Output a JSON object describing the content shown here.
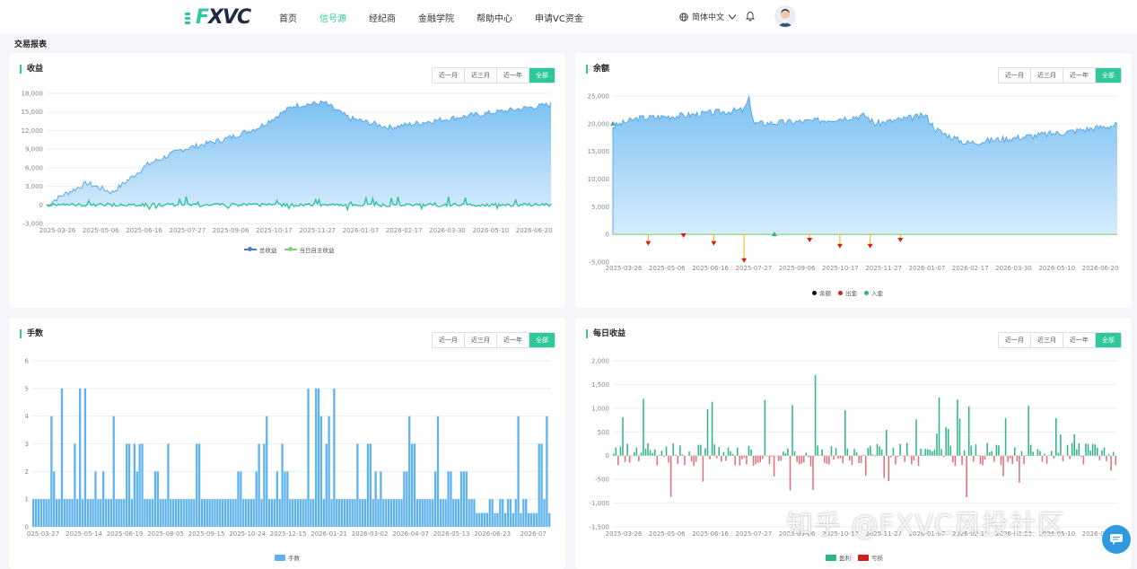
{
  "header": {
    "logo_text": "FXVC",
    "nav": [
      {
        "label": "首页",
        "active": false
      },
      {
        "label": "信号源",
        "active": true
      },
      {
        "label": "经纪商",
        "active": false
      },
      {
        "label": "金融学院",
        "active": false
      },
      {
        "label": "帮助中心",
        "active": false
      },
      {
        "label": "申请VC资金",
        "active": false
      }
    ],
    "language": "简体中文",
    "icons": [
      "globe-icon",
      "chevron-down-icon",
      "bell-icon",
      "avatar"
    ]
  },
  "page_title": "交易报表",
  "range_options": [
    "近一月",
    "近三月",
    "近一年",
    "全部"
  ],
  "range_selected": "全部",
  "watermark": "知乎 @FXVC风投社区",
  "colors": {
    "accent": "#2fc79c",
    "blue": "#5eb3ee",
    "profit": "#2fb38a",
    "loss": "#e0707a",
    "red": "#d0201a",
    "yellow": "#f5c11b"
  },
  "panels": {
    "profit": {
      "title": "收益",
      "legend": [
        "总收益",
        "当日自主收益"
      ]
    },
    "balance": {
      "title": "余额",
      "legend": [
        "余额",
        "出金",
        "入金"
      ]
    },
    "lots": {
      "title": "手数",
      "legend": [
        "手数"
      ]
    },
    "daily": {
      "title": "每日收益",
      "legend": [
        "盈利",
        "亏损"
      ]
    }
  },
  "chart_data": [
    {
      "type": "area",
      "id": "profit",
      "title": "收益",
      "x_ticks": [
        "2025-03-26",
        "2025-05-06",
        "2025-06-16",
        "2025-07-27",
        "2025-09-06",
        "2025-10-17",
        "2025-11-27",
        "2026-01-07",
        "2026-02-17",
        "2026-03-30",
        "2026-05-10",
        "2026-06-20"
      ],
      "y_ticks": [
        "18,000",
        "15,000",
        "12,000",
        "9,000",
        "6,000",
        "3,000",
        "0",
        "-3,000"
      ],
      "ylim": [
        -3000,
        18000
      ],
      "series": [
        {
          "name": "总收益",
          "key_points": [
            [
              0,
              0
            ],
            [
              0.03,
              1500
            ],
            [
              0.08,
              3500
            ],
            [
              0.13,
              2000
            ],
            [
              0.2,
              6500
            ],
            [
              0.27,
              9000
            ],
            [
              0.35,
              10500
            ],
            [
              0.42,
              12500
            ],
            [
              0.49,
              16000
            ],
            [
              0.55,
              16500
            ],
            [
              0.6,
              14000
            ],
            [
              0.68,
              12500
            ],
            [
              0.76,
              13500
            ],
            [
              0.85,
              14500
            ],
            [
              1.0,
              16200
            ]
          ]
        },
        {
          "name": "当日自主收益",
          "approx_range": [
            -800,
            1500
          ]
        }
      ]
    },
    {
      "type": "area",
      "id": "balance",
      "title": "余额",
      "x_ticks": [
        "2025-03-26",
        "2025-05-06",
        "2025-06-16",
        "2025-07-27",
        "2025-09-06",
        "2025-10-17",
        "2025-11-27",
        "2026-01-07",
        "2026-02-17",
        "2026-03-30",
        "2026-05-10",
        "2026-06-20"
      ],
      "y_ticks": [
        "25,000",
        "20,000",
        "15,000",
        "10,000",
        "5,000",
        "0",
        "-5,000"
      ],
      "ylim": [
        -5000,
        25000
      ],
      "series": [
        {
          "name": "余额",
          "key_points": [
            [
              0,
              19500
            ],
            [
              0.05,
              21000
            ],
            [
              0.14,
              21500
            ],
            [
              0.26,
              22500
            ],
            [
              0.27,
              24500
            ],
            [
              0.28,
              20000
            ],
            [
              0.4,
              20500
            ],
            [
              0.5,
              21500
            ],
            [
              0.52,
              20000
            ],
            [
              0.62,
              21500
            ],
            [
              0.64,
              19000
            ],
            [
              0.65,
              18500
            ],
            [
              0.7,
              16500
            ],
            [
              0.8,
              17500
            ],
            [
              0.9,
              18500
            ],
            [
              1.0,
              19800
            ]
          ]
        },
        {
          "name": "出金",
          "approx_points": [
            [
              0.07,
              -1700
            ],
            [
              0.14,
              -300
            ],
            [
              0.2,
              -1700
            ],
            [
              0.26,
              -4800
            ],
            [
              0.39,
              -1100
            ],
            [
              0.45,
              -2200
            ],
            [
              0.51,
              -2200
            ],
            [
              0.57,
              -1100
            ]
          ]
        },
        {
          "name": "入金",
          "approx_points": [
            [
              0,
              20000
            ],
            [
              0.32,
              0
            ]
          ]
        }
      ]
    },
    {
      "type": "bar",
      "id": "lots",
      "title": "手数",
      "x_ticks": [
        "025-03-27",
        "2025-05-14",
        "2025-06-19",
        "2025-08-05",
        "2025-09-15",
        "2025-10-24",
        "2025-12-15",
        "2026-01-21",
        "2026-03-02",
        "2026-04-07",
        "2026-05-13",
        "2026-06-23",
        "2026-07"
      ],
      "y_ticks": [
        "6",
        "5",
        "4",
        "3",
        "2",
        "1",
        "0"
      ],
      "ylim": [
        0,
        6
      ],
      "series": [
        {
          "name": "手数",
          "approx_range": [
            0.5,
            6
          ]
        }
      ]
    },
    {
      "type": "bar",
      "id": "daily",
      "title": "每日收益",
      "x_ticks": [
        "2025-03-26",
        "2025-05-06",
        "2025-06-16",
        "2025-07-27",
        "2025-09-06",
        "2025-10-17",
        "2025-11-27",
        "2026-01-07",
        "2026-02-17",
        "2026-03-30",
        "2026-05-10",
        "2026-06-20"
      ],
      "y_ticks": [
        "2,000",
        "1,500",
        "1,000",
        "500",
        "0",
        "-500",
        "-1,000",
        "-1,500"
      ],
      "ylim": [
        -1500,
        2000
      ],
      "series": [
        {
          "name": "盈利",
          "approx_range": [
            0,
            1700
          ]
        },
        {
          "name": "亏损",
          "approx_range": [
            -1000,
            0
          ]
        }
      ]
    }
  ]
}
